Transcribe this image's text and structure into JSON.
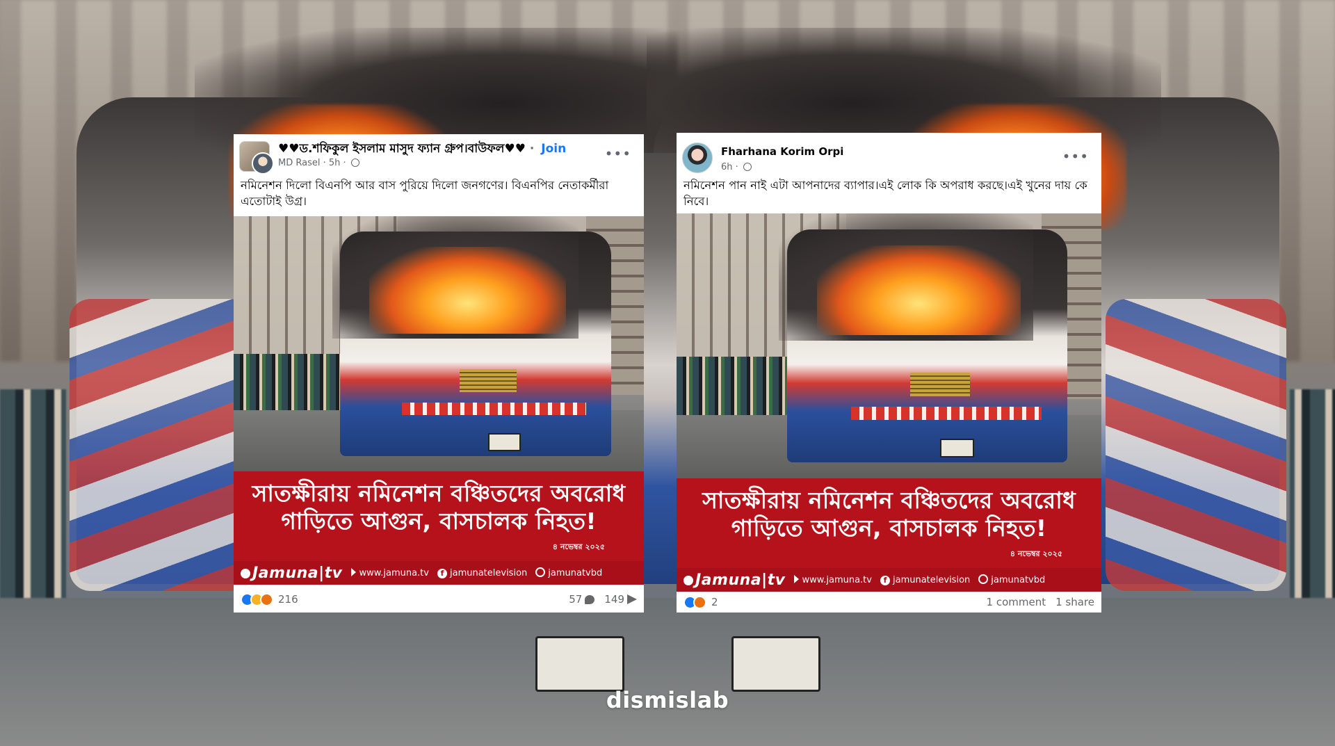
{
  "posts": [
    {
      "group_name": "♥♥ড.শফিকুল ইসলাম মাসুদ ফ্যান গ্রুপ।বাউফল♥♥",
      "join_label": "Join",
      "author": "MD Rasel",
      "time": "5h",
      "caption": "নমিনেশন দিলো বিএনপি আর বাস পুরিয়ে দিলো জনগণের। বিএনপির নেতাকর্মীরা এতোটাই উগ্র।",
      "headline": "সাতক্ষীরায় নমিনেশন বঞ্চিতদের অবরোধ গাড়িতে  আগুন, বাসচালক নিহত!",
      "news_date": "৪ নভেম্বর ২০২৫",
      "brand": "Jamuna|tv",
      "website": "www.jamuna.tv",
      "facebook": "jamunatelevision",
      "youtube": "jamunatvbd",
      "reaction_count": "216",
      "comments": "57",
      "shares": "149"
    },
    {
      "author": "Fharhana Korim Orpi",
      "time": "6h",
      "caption": "নমিনেশন পান নাই এটা আপনাদের ব্যাপার।এই লোক কি অপরাধ করছে।এই খুনের দায় কে নিবে।",
      "headline": "সাতক্ষীরায় নমিনেশন বঞ্চিতদের অবরোধ গাড়িতে  আগুন, বাসচালক নিহত!",
      "news_date": "৪ নভেম্বর ২০২৫",
      "brand": "Jamuna|tv",
      "website": "www.jamuna.tv",
      "facebook": "jamunatelevision",
      "youtube": "jamunatvbd",
      "reaction_count": "2",
      "comments": "1 comment",
      "shares": "1 share"
    }
  ],
  "watermark": "dismislab",
  "colors": {
    "news_red": "#b5121b",
    "fb_blue": "#1877f2",
    "meta_gray": "#65676b"
  }
}
